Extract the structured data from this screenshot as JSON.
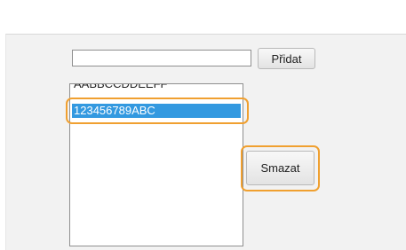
{
  "form": {
    "input_value": "",
    "add_label": "Přidat",
    "delete_label": "Smazat"
  },
  "list": {
    "items": [
      "AABBCCDDEEFF",
      "123456789ABC"
    ],
    "selected_index": 1
  },
  "colors": {
    "highlight": "#f0a030",
    "selection": "#3399e0"
  }
}
